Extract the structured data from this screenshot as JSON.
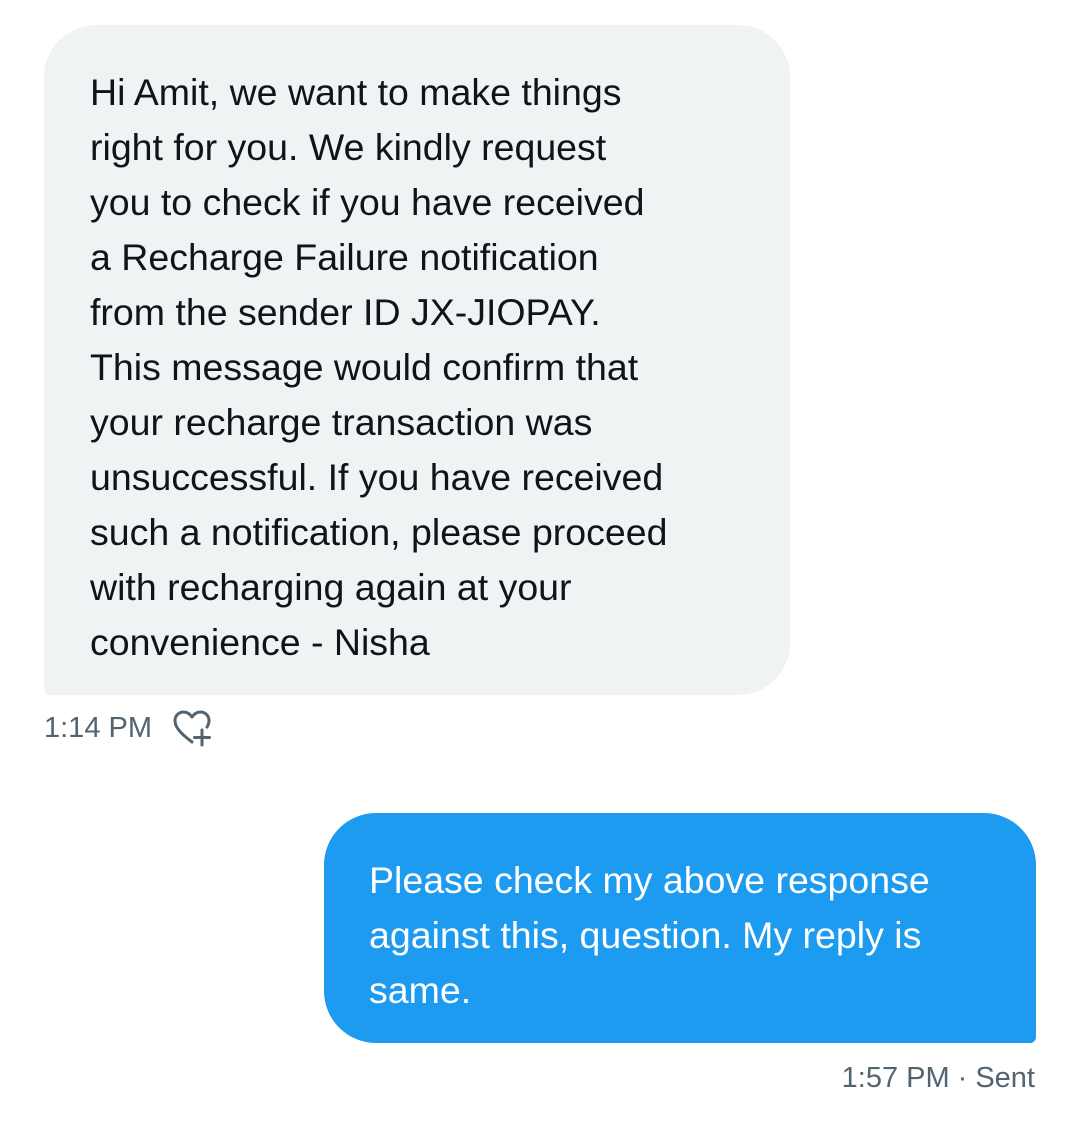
{
  "conversation": {
    "incoming": {
      "text": "Hi Amit, we want to make things\nright for you. We kindly request\nyou to check if you have received\na Recharge Failure notification\nfrom the sender ID JX-JIOPAY.\nThis message would confirm that\nyour recharge transaction was\nunsuccessful. If you have received\nsuch a notification, please proceed\nwith recharging again at your\nconvenience - Nisha",
      "timestamp": "1:14 PM",
      "reaction_icon": "heart-plus-icon"
    },
    "outgoing": {
      "text": "Please check my above response\nagainst this, question. My reply is\nsame.",
      "timestamp": "1:57 PM",
      "separator": "·",
      "status": "Sent"
    }
  },
  "colors": {
    "incoming_bubble": "#eff3f4",
    "outgoing_bubble": "#1d9bf0",
    "meta_text": "#536471",
    "primary_text": "#0f1419"
  }
}
